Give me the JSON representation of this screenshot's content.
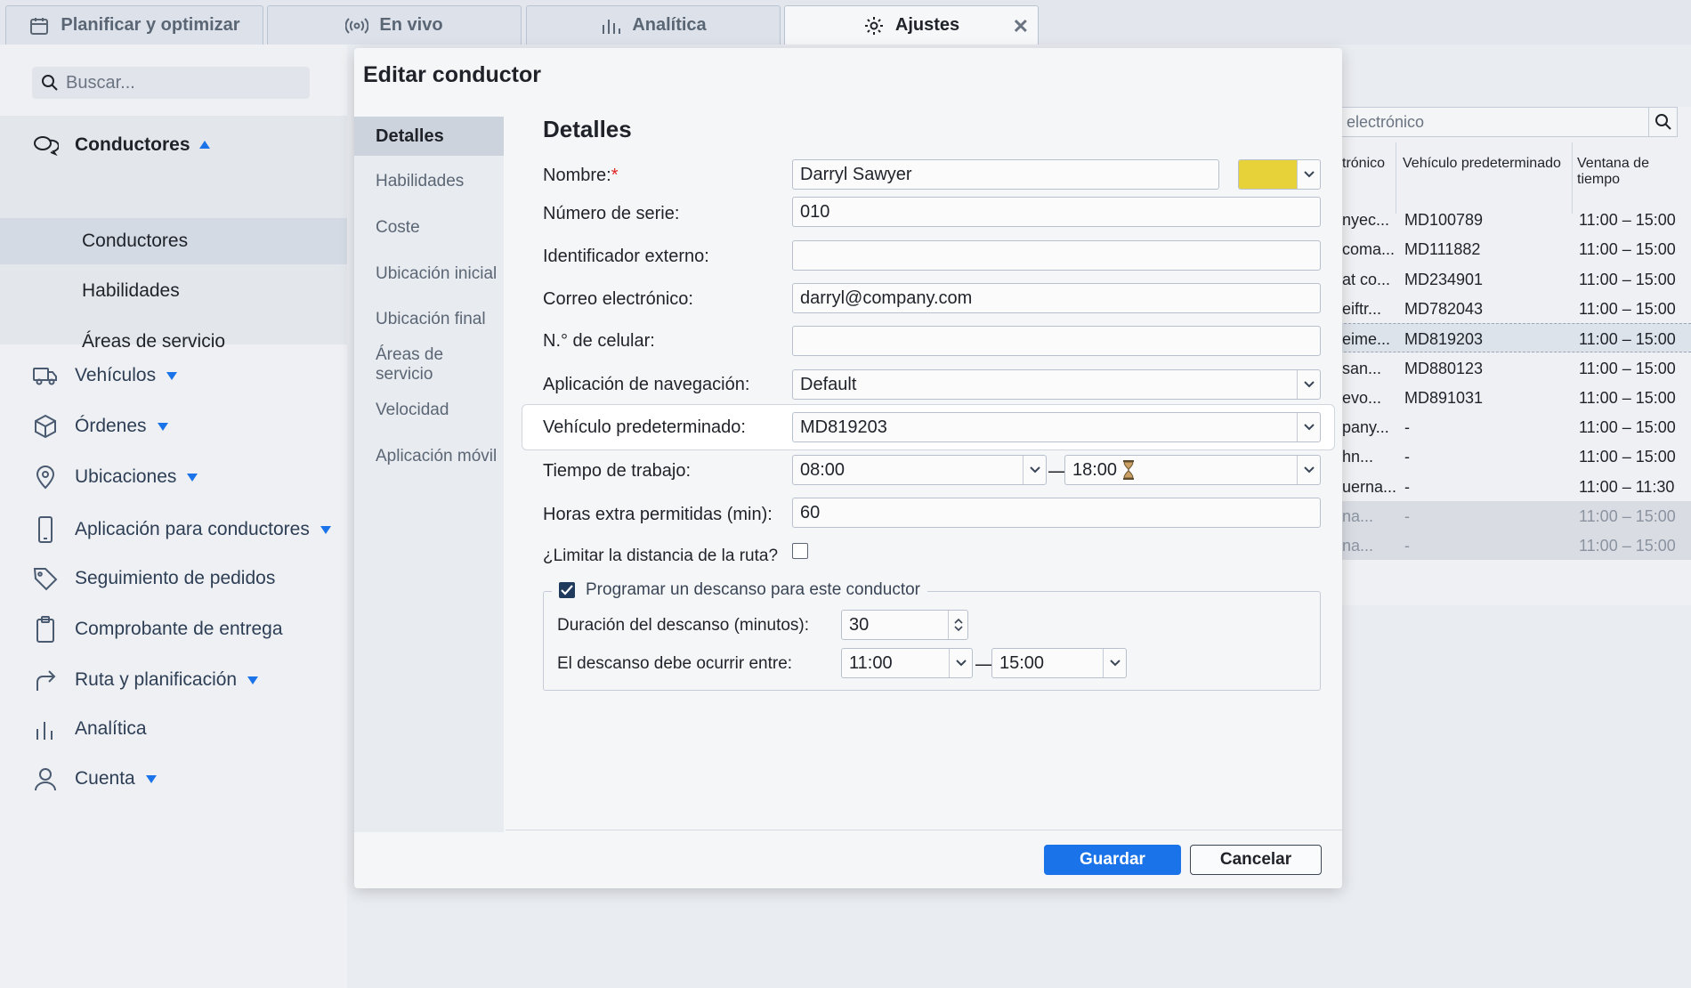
{
  "tabs": [
    {
      "label": "Planificar y optimizar",
      "icon": "calendar-icon"
    },
    {
      "label": "En vivo",
      "icon": "broadcast-icon"
    },
    {
      "label": "Analítica",
      "icon": "bar-chart-icon"
    },
    {
      "label": "Ajustes",
      "icon": "gear-icon",
      "close": "✕"
    }
  ],
  "sidebar": {
    "search_placeholder": "Buscar...",
    "group": {
      "label": "Conductores",
      "items": [
        "Conductores",
        "Habilidades",
        "Áreas de servicio"
      ]
    },
    "items": [
      {
        "label": "Vehículos",
        "icon": "truck-icon"
      },
      {
        "label": "Órdenes",
        "icon": "box-icon"
      },
      {
        "label": "Ubicaciones",
        "icon": "map-pin-icon"
      },
      {
        "label": "Aplicación para conductores",
        "icon": "phone-icon"
      },
      {
        "label": "Seguimiento de pedidos",
        "icon": "tag-icon"
      },
      {
        "label": "Comprobante de entrega",
        "icon": "clipboard-icon"
      },
      {
        "label": "Ruta y planificación",
        "icon": "route-icon"
      },
      {
        "label": "Analítica",
        "icon": "bar-chart-icon"
      },
      {
        "label": "Cuenta",
        "icon": "user-icon"
      }
    ]
  },
  "background_table": {
    "search_placeholder": "electrónico",
    "headers": [
      "trónico",
      "Vehículo predeterminado",
      "Ventana de tiempo"
    ],
    "rows": [
      [
        "nyec...",
        "MD100789",
        "11:00 – 15:00"
      ],
      [
        "coma...",
        "MD111882",
        "11:00 – 15:00"
      ],
      [
        "at co...",
        "MD234901",
        "11:00 – 15:00"
      ],
      [
        "eiftr...",
        "MD782043",
        "11:00 – 15:00"
      ],
      [
        "eime...",
        "MD819203",
        "11:00 – 15:00"
      ],
      [
        "san...",
        "MD880123",
        "11:00 – 15:00"
      ],
      [
        "evo...",
        "MD891031",
        "11:00 – 15:00"
      ],
      [
        "pany...",
        "-",
        "11:00 – 15:00"
      ],
      [
        "hn...",
        "-",
        "11:00 – 15:00"
      ],
      [
        "uerna...",
        "-",
        "11:00 – 11:30"
      ],
      [
        "na...",
        "-",
        "11:00 – 15:00"
      ],
      [
        "na...",
        "-",
        "11:00 – 15:00"
      ]
    ]
  },
  "modal": {
    "title": "Editar conductor",
    "nav": [
      "Detalles",
      "Habilidades",
      "Coste",
      "Ubicación inicial",
      "Ubicación final",
      "Áreas de servicio",
      "Velocidad",
      "Aplicación móvil"
    ],
    "section_title": "Detalles",
    "fields": {
      "name_label": "Nombre:",
      "name_required": "*",
      "name_value": "Darryl Sawyer",
      "color": "#e8d23a",
      "serial_label": "Número de serie:",
      "serial_value": "010",
      "external_id_label": "Identificador externo:",
      "external_id_value": "",
      "email_label": "Correo electrónico:",
      "email_value": "darryl@company.com",
      "phone_label": "N.° de celular:",
      "phone_value": "",
      "nav_app_label": "Aplicación de navegación:",
      "nav_app_value": "Default",
      "vehicle_label": "Vehículo predeterminado:",
      "vehicle_value": "MD819203",
      "work_time_label": "Tiempo de trabajo:",
      "work_start": "08:00",
      "work_sep": "—",
      "work_end": "18:00",
      "overtime_label": "Horas extra permitidas (min):",
      "overtime_value": "60",
      "limit_distance_label": "¿Limitar la distancia de la ruta?",
      "limit_distance_checked": false
    },
    "break": {
      "legend": "Programar un descanso para este conductor",
      "checked": true,
      "duration_label": "Duración del descanso (minutos):",
      "duration_value": "30",
      "window_label": "El descanso debe ocurrir entre:",
      "window_start": "11:00",
      "window_sep": "—",
      "window_end": "15:00"
    },
    "save_label": "Guardar",
    "cancel_label": "Cancelar"
  }
}
